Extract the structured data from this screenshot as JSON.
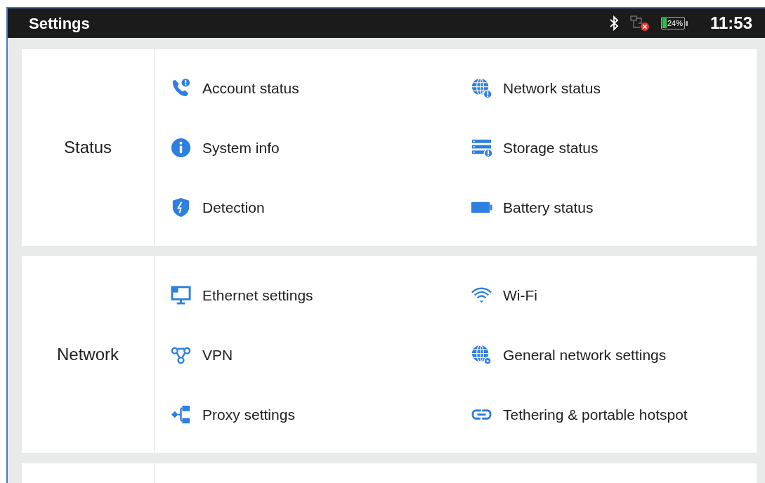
{
  "status_bar": {
    "title": "Settings",
    "battery": "24%",
    "time": "11:53"
  },
  "sections": [
    {
      "label": "Status",
      "items": [
        {
          "label": "Account status"
        },
        {
          "label": "Network status"
        },
        {
          "label": "System info"
        },
        {
          "label": "Storage status"
        },
        {
          "label": "Detection"
        },
        {
          "label": "Battery status"
        }
      ]
    },
    {
      "label": "Network",
      "items": [
        {
          "label": "Ethernet settings"
        },
        {
          "label": "Wi-Fi"
        },
        {
          "label": "VPN"
        },
        {
          "label": "General network settings"
        },
        {
          "label": "Proxy settings"
        },
        {
          "label": "Tethering & portable hotspot"
        }
      ]
    }
  ]
}
